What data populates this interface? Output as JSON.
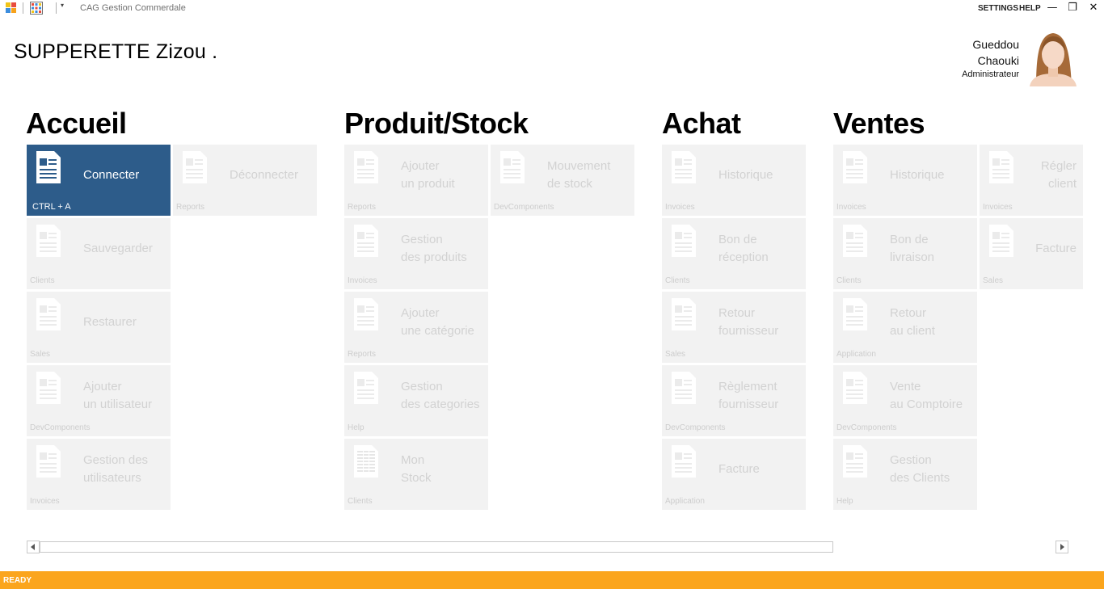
{
  "titlebar": {
    "app_title": "CAG Gestion Commerdale",
    "settings_label": "SETTINGS",
    "help_label": "HELP",
    "minimize_glyph": "—",
    "restore_glyph": "❐",
    "close_glyph": "✕",
    "dropdown_glyph": "▾"
  },
  "header": {
    "store_name": "SUPPERETTE Zizou .",
    "user": {
      "first_name": "Gueddou",
      "last_name": "Chaouki",
      "role": "Administrateur"
    }
  },
  "groups": {
    "accueil": {
      "title": "Accueil",
      "tiles": [
        {
          "label": "Connecter",
          "sub": "CTRL + A"
        },
        {
          "label": "Déconnecter",
          "sub": "Reports"
        },
        {
          "label": "Sauvegarder",
          "sub": "Clients"
        },
        {
          "label": "Restaurer",
          "sub": "Sales"
        },
        {
          "label": "Ajouter\nun utilisateur",
          "sub": "DevComponents"
        },
        {
          "label": "Gestion des\nutilisateurs",
          "sub": "Invoices"
        }
      ]
    },
    "produit_stock": {
      "title": "Produit/Stock",
      "tiles": [
        {
          "label": "Ajouter\nun produit",
          "sub": "Reports"
        },
        {
          "label": "Mouvement\nde stock",
          "sub": "DevComponents"
        },
        {
          "label": "Gestion\ndes produits",
          "sub": "Invoices"
        },
        {
          "label": "Ajouter\nune catégorie",
          "sub": "Reports"
        },
        {
          "label": "Gestion\ndes categories",
          "sub": "Help"
        },
        {
          "label": "Mon\nStock",
          "sub": "Clients"
        }
      ]
    },
    "achat": {
      "title": "Achat",
      "tiles": [
        {
          "label": "Historique",
          "sub": "Invoices"
        },
        {
          "label": "Bon de\nréception",
          "sub": "Clients"
        },
        {
          "label": "Retour\nfournisseur",
          "sub": "Sales"
        },
        {
          "label": "Règlement\nfournisseur",
          "sub": "DevComponents"
        },
        {
          "label": "Facture",
          "sub": "Application"
        }
      ]
    },
    "ventes": {
      "title": "Ventes",
      "tiles": [
        {
          "label": "Historique",
          "sub": "Invoices"
        },
        {
          "label": "Régler\nclient",
          "sub": "Invoices"
        },
        {
          "label": "Bon de\nlivraison",
          "sub": "Clients"
        },
        {
          "label": "Facture",
          "sub": "Sales"
        },
        {
          "label": "Retour\nau client",
          "sub": "Application"
        },
        {
          "label": "Vente\nau Comptoire",
          "sub": "DevComponents"
        },
        {
          "label": "Gestion\ndes Clients",
          "sub": "Help"
        }
      ]
    }
  },
  "statusbar": {
    "text": "READY"
  },
  "colors": {
    "active_tile": "#2d5c8a",
    "inactive_tile": "#f2f2f2",
    "status_bar": "#fba51d"
  }
}
